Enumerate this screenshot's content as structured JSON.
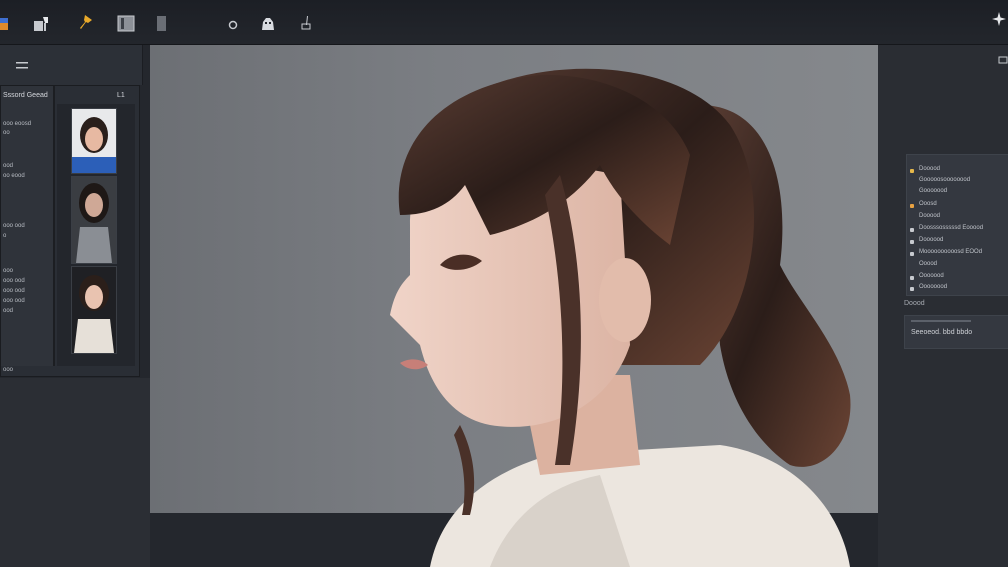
{
  "toolbar": {
    "tools": [
      {
        "name": "color-swatch-icon"
      },
      {
        "name": "pen-tool-icon"
      },
      {
        "name": "pin-icon",
        "color": "#e8a92a"
      },
      {
        "name": "layer-icon"
      },
      {
        "name": "document-icon"
      },
      {
        "name": "circle-icon"
      },
      {
        "name": "robot-icon"
      },
      {
        "name": "brush-icon"
      }
    ],
    "right_icon": "sparkle-icon"
  },
  "left_panel": {
    "title": "Sssord Geead",
    "number": "L1",
    "text_lines": [
      "ooo eoosd",
      "oo",
      "ood",
      "oo eood",
      "ooo ood",
      "o",
      "ooo",
      "ooo ood",
      "ooo ood",
      "ooo ood",
      "ood",
      "ooo"
    ],
    "thumbnails": [
      {
        "name": "portrait-thumbnail-1",
        "accent": "#2c5fb8"
      },
      {
        "name": "portrait-thumbnail-2",
        "accent": "#8a8e94"
      },
      {
        "name": "portrait-thumbnail-3",
        "accent": "#e6e0d8"
      }
    ]
  },
  "right_panel": {
    "rows": [
      {
        "label": "Dooood",
        "dot": "#e6b84a"
      },
      {
        "label": "Gooooosoooooood",
        "dot": null
      },
      {
        "label": "Gooooood",
        "dot": null
      },
      {
        "label": "Ooosd",
        "dot": "#e8a242"
      },
      {
        "label": "Dooood",
        "dot": null
      },
      {
        "label": "Doosssosssssd Eooood",
        "dot": "#c7cacf"
      },
      {
        "label": "Doooood",
        "dot": "#c7cacf"
      },
      {
        "label": "Moooooooooosd EOOd",
        "dot": "#c7cacf"
      },
      {
        "label": "Ooood",
        "dot": null
      },
      {
        "label": "Ooooood",
        "dot": "#c7cacf"
      },
      {
        "label": "Oooooood",
        "dot": "#c7cacf"
      }
    ],
    "section_label": "Doood",
    "field_value": "Seeoeod. bbd bbdo"
  },
  "colors": {
    "canvas_bg": "#7b7e83",
    "panel_bg": "#2a2d33",
    "accent": "#e8a92a"
  }
}
